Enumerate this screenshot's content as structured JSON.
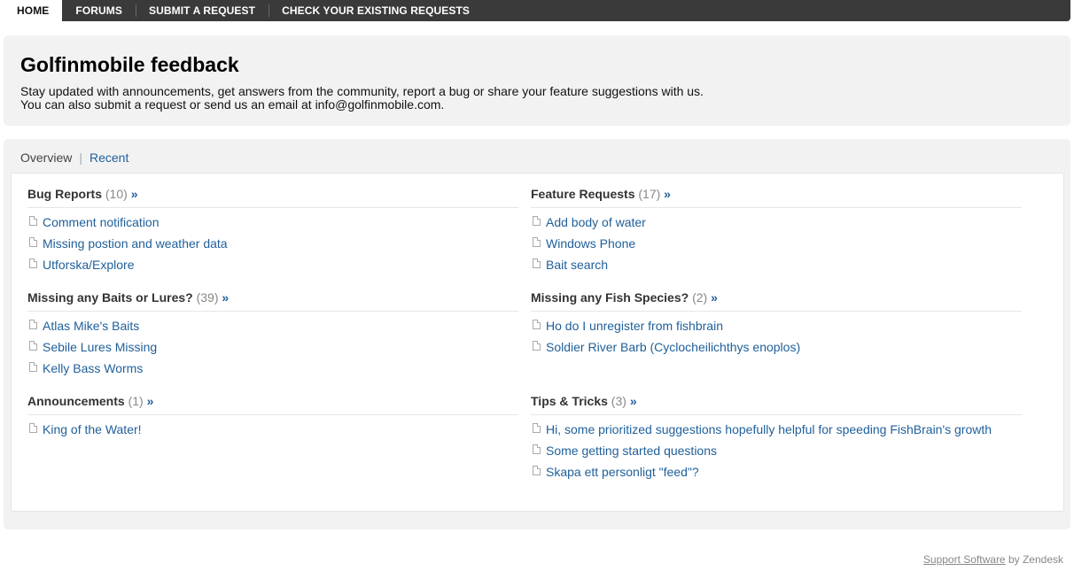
{
  "nav": {
    "tabs": [
      {
        "label": "HOME"
      },
      {
        "label": "FORUMS"
      },
      {
        "label": "SUBMIT A REQUEST"
      },
      {
        "label": "CHECK YOUR EXISTING REQUESTS"
      }
    ]
  },
  "header": {
    "title": "Golfinmobile feedback",
    "line1": "Stay updated with announcements, get answers from the community, report a bug or share your feature suggestions with us.",
    "line2": "You can also submit a request or send us an email at info@golfinmobile.com."
  },
  "subnav": {
    "overview": "Overview",
    "separator": "|",
    "recent": "Recent"
  },
  "sections": [
    {
      "title": "Bug Reports",
      "count": "(10)",
      "arrow": "»",
      "items": [
        "Comment notification",
        "Missing postion and weather data",
        "Utforska/Explore"
      ]
    },
    {
      "title": "Feature Requests",
      "count": "(17)",
      "arrow": "»",
      "items": [
        "Add body of water",
        "Windows Phone",
        "Bait search"
      ]
    },
    {
      "title": "Missing any Baits or Lures?",
      "count": "(39)",
      "arrow": "»",
      "items": [
        "Atlas Mike's Baits",
        "Sebile Lures Missing",
        "Kelly Bass Worms"
      ]
    },
    {
      "title": "Missing any Fish Species?",
      "count": "(2)",
      "arrow": "»",
      "items": [
        "Ho do I unregister from fishbrain",
        "Soldier River Barb (Cyclocheilichthys enoplos)"
      ]
    },
    {
      "title": "Announcements",
      "count": "(1)",
      "arrow": "»",
      "items": [
        "King of the Water!"
      ]
    },
    {
      "title": "Tips & Tricks",
      "count": "(3)",
      "arrow": "»",
      "items": [
        "Hi, some prioritized suggestions hopefully helpful for speeding FishBrain's growth",
        "Some getting started questions",
        "Skapa ett personligt \"feed\"?"
      ]
    }
  ],
  "footer": {
    "link": "Support Software",
    "suffix": "by Zendesk"
  },
  "colors": {
    "link": "#1f5f9a",
    "nav_bg": "#3a3a3a",
    "panel_bg": "#f2f2f2"
  },
  "icons": {
    "item_icon": "document-icon"
  }
}
